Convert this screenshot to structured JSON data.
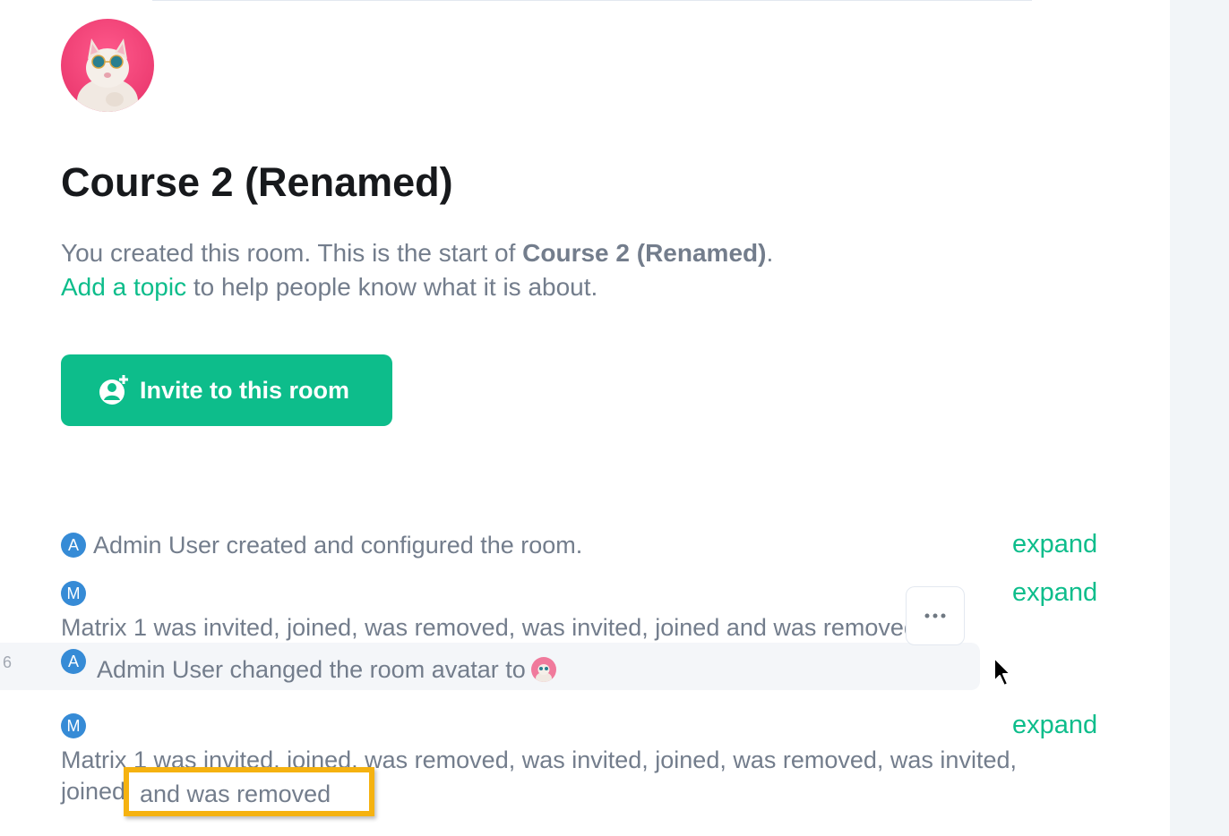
{
  "room": {
    "title": "Course 2 (Renamed)",
    "intro_prefix": "You created this room. This is the start of ",
    "intro_room_name": "Course 2 (Renamed)",
    "intro_suffix": ".",
    "topic_link": "Add a topic",
    "topic_suffix": " to help people know what it is about.",
    "invite_button": "Invite to this room"
  },
  "timeline": {
    "line_number": "6",
    "events": [
      {
        "avatar": "A",
        "text": "Admin User created and configured the room.",
        "action": "expand"
      },
      {
        "avatar": "M",
        "text": "Matrix 1 was invited, joined, was removed, was invited, joined and was removed",
        "action": "expand"
      },
      {
        "avatar": "A",
        "text": "Admin User changed the room avatar to"
      },
      {
        "avatar": "M",
        "text_line1": "Matrix 1 was invited, joined, was removed, was invited, joined, was removed, was invited,",
        "text_line2_prefix": "joined",
        "text_line2_highlight": "and was removed",
        "action": "expand"
      }
    ]
  },
  "colors": {
    "accent": "#0dbd8b",
    "avatar_blue": "#368bd6",
    "highlight": "#f5b210"
  },
  "icons": {
    "options": "more-options-icon",
    "invite": "invite-user-icon",
    "cursor": "mouse-cursor-icon"
  }
}
